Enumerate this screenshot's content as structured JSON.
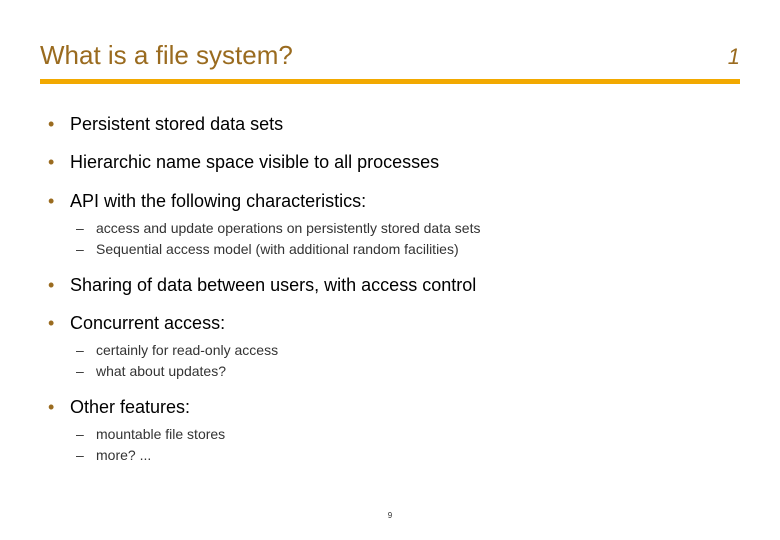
{
  "header": {
    "title": "What is a file system?",
    "slide_number": "1"
  },
  "bullets": [
    {
      "text": "Persistent stored data sets",
      "sub": []
    },
    {
      "text": "Hierarchic name space visible to all processes",
      "sub": []
    },
    {
      "text": "API with the following characteristics:",
      "sub": [
        "access and update operations on persistently stored data sets",
        "Sequential access model (with additional random facilities)"
      ]
    },
    {
      "text": "Sharing of data between users, with access control",
      "sub": []
    },
    {
      "text": "Concurrent access:",
      "sub": [
        "certainly for read-only access",
        "what about updates?"
      ]
    },
    {
      "text": "Other features:",
      "sub": [
        "mountable file stores",
        "more? ..."
      ]
    }
  ],
  "footer": {
    "page": "9"
  }
}
